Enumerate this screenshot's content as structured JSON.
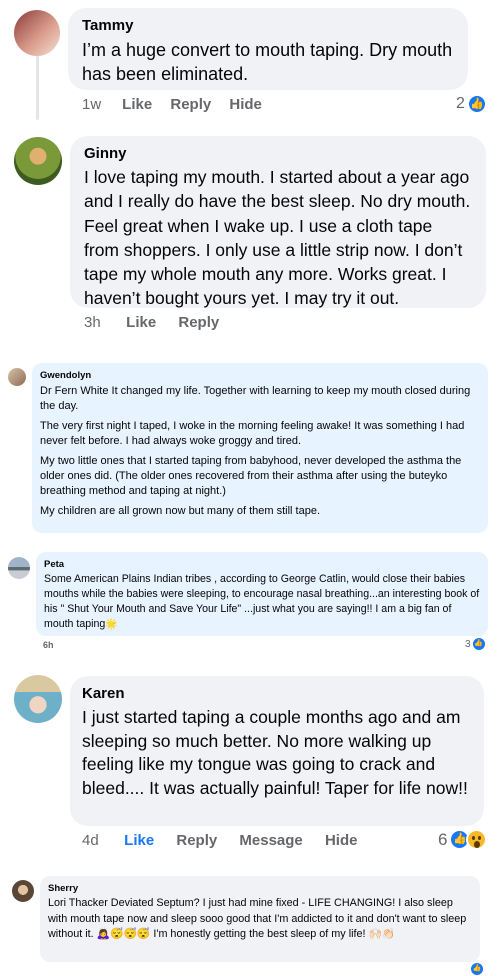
{
  "comments": [
    {
      "author": "Tammy",
      "text": "I’m a huge convert to mouth taping. Dry mouth has been eliminated.",
      "actions": {
        "time": "1w",
        "like": "Like",
        "reply": "Reply",
        "hide": "Hide"
      },
      "reaction_count": "2"
    },
    {
      "author": "Ginny",
      "text": "I love taping my mouth. I started about a year ago and I really do have the best sleep. No dry mouth. Feel great when I wake up. I use a cloth tape from shoppers. I only use a little strip now. I don’t tape my whole mouth any more. Works great. I haven’t bought yours yet. I may try it out.",
      "actions": {
        "time": "3h",
        "like": "Like",
        "reply": "Reply"
      }
    },
    {
      "author": "Gwendolyn",
      "paragraphs": [
        "Dr Fern White It changed my life. Together with learning to keep my mouth closed during the day.",
        "The very first night I taped, I woke in the morning feeling awake! It was something I had never felt before. I had always woke groggy and tired.",
        "My two little ones that I started taping from babyhood, never developed the asthma the older ones did. (The older ones recovered from their asthma after using the buteyko breathing method and taping at night.)",
        "My children are all grown now but many of them still tape."
      ]
    },
    {
      "author": "Peta",
      "text": "Some American Plains Indian tribes , according to George Catlin, would close their babies mouths while the babies were sleeping, to encourage nasal breathing...an interesting book of his \" Shut Your Mouth and Save Your Life\" ...just what you are saying!! I am a big fan of mouth taping",
      "emoji": "🌟",
      "actions": {
        "time": "6h"
      },
      "reaction_count": "3"
    },
    {
      "author": "Karen",
      "text": "I just started taping a couple months ago and am sleeping so much better. No more walking up feeling like my tongue was going to crack and bleed.... It was actually painful! Taper for life now!!",
      "actions": {
        "time": "4d",
        "like": "Like",
        "reply": "Reply",
        "message": "Message",
        "hide": "Hide"
      },
      "reaction_count": "6"
    },
    {
      "author": "Sherry",
      "text": "Lori Thacker Deviated Septum? I just had mine fixed - LIFE CHANGING! I also sleep with mouth tape now and sleep sooo good that I'm addicted to it and don't want to sleep without it. 🙇‍♀️😴😴😴 I'm honestly getting the best sleep of my life! 🙌🏻👏🏻"
    }
  ],
  "colors": {
    "bubble": "#f0f2f5",
    "bubble_blue": "#e7f3ff",
    "like_blue": "#1877f2",
    "meta_gray": "#65676b"
  }
}
